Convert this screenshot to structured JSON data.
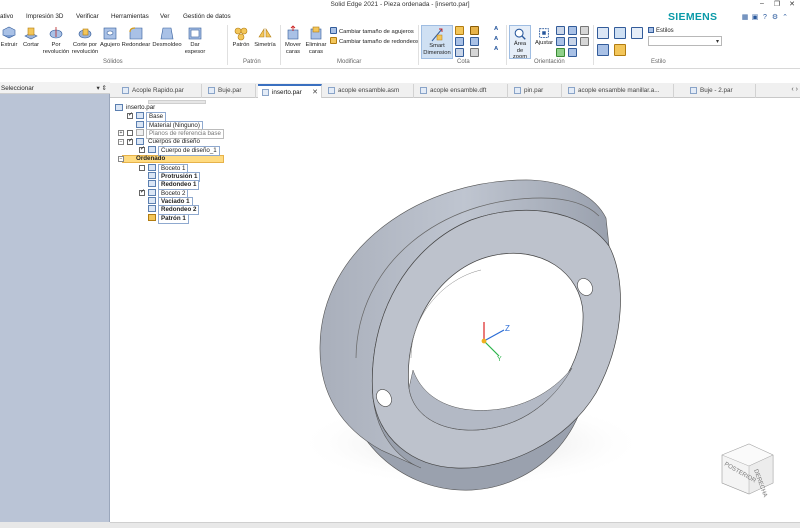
{
  "window": {
    "title": "Solid Edge 2021 - Pieza ordenada - [inserto.par]",
    "brand": "SIEMENS"
  },
  "menu": [
    "ativo",
    "Impresión 3D",
    "Verificar",
    "Herramientas",
    "Ver",
    "Gestión de datos"
  ],
  "ribbon": {
    "solidos": {
      "label": "Sólidos",
      "buttons": [
        "Extruir",
        "Cortar",
        "Por revolución",
        "Corte por revolución",
        "Agujero",
        "Redondear",
        "Desmoldeo",
        "Dar espesor"
      ]
    },
    "patron": {
      "label": "Patrón",
      "buttons": [
        "Patrón",
        "Simetría"
      ]
    },
    "modificar": {
      "label": "Modificar",
      "buttons": [
        "Mover caras",
        "Eliminar caras"
      ],
      "small": [
        "Cambiar tamaño de agujeros",
        "Cambiar tamaño de redondeos"
      ]
    },
    "cota": {
      "label": "Cota",
      "smart": "Smart Dimension"
    },
    "orientacion": {
      "label": "Orientación",
      "zoom": "Área de zoom",
      "fit": "Ajustar"
    },
    "estilo": {
      "label": "Estilo",
      "styles": "Estilos"
    }
  },
  "sidebar": {
    "title": "Seleccionar"
  },
  "tabs": [
    "Acople Rapido.par",
    "Buje.par",
    "inserto.par",
    "acople ensamble.asm",
    "acople ensamble.dft",
    "pin.par",
    "acople ensamble manillar.a...",
    "Buje - 2.par"
  ],
  "active_tab": "inserto.par",
  "tree": {
    "root": "inserto.par",
    "base": "Base",
    "material": "Material (Ninguno)",
    "planes": "Planos de referencia base",
    "bodies": "Cuerpos de diseño",
    "body1": "Cuerpo de diseño_1",
    "ordered": "Ordenado",
    "features": [
      "Boceto 1",
      "Protrusión 1",
      "Redondeo 1",
      "Boceto 2",
      "Vaciado 1",
      "Redondeo 2",
      "Patrón 1"
    ]
  },
  "viewcube": {
    "faces": [
      "POSTERIOR",
      "DERECHA"
    ]
  },
  "colors": {
    "accent": "#3a70c0",
    "sidebar_bg": "#bac4d6",
    "part": "#b9bfca",
    "ordered_highlight": "#ffdb80",
    "brand": "#0a9aa8"
  }
}
